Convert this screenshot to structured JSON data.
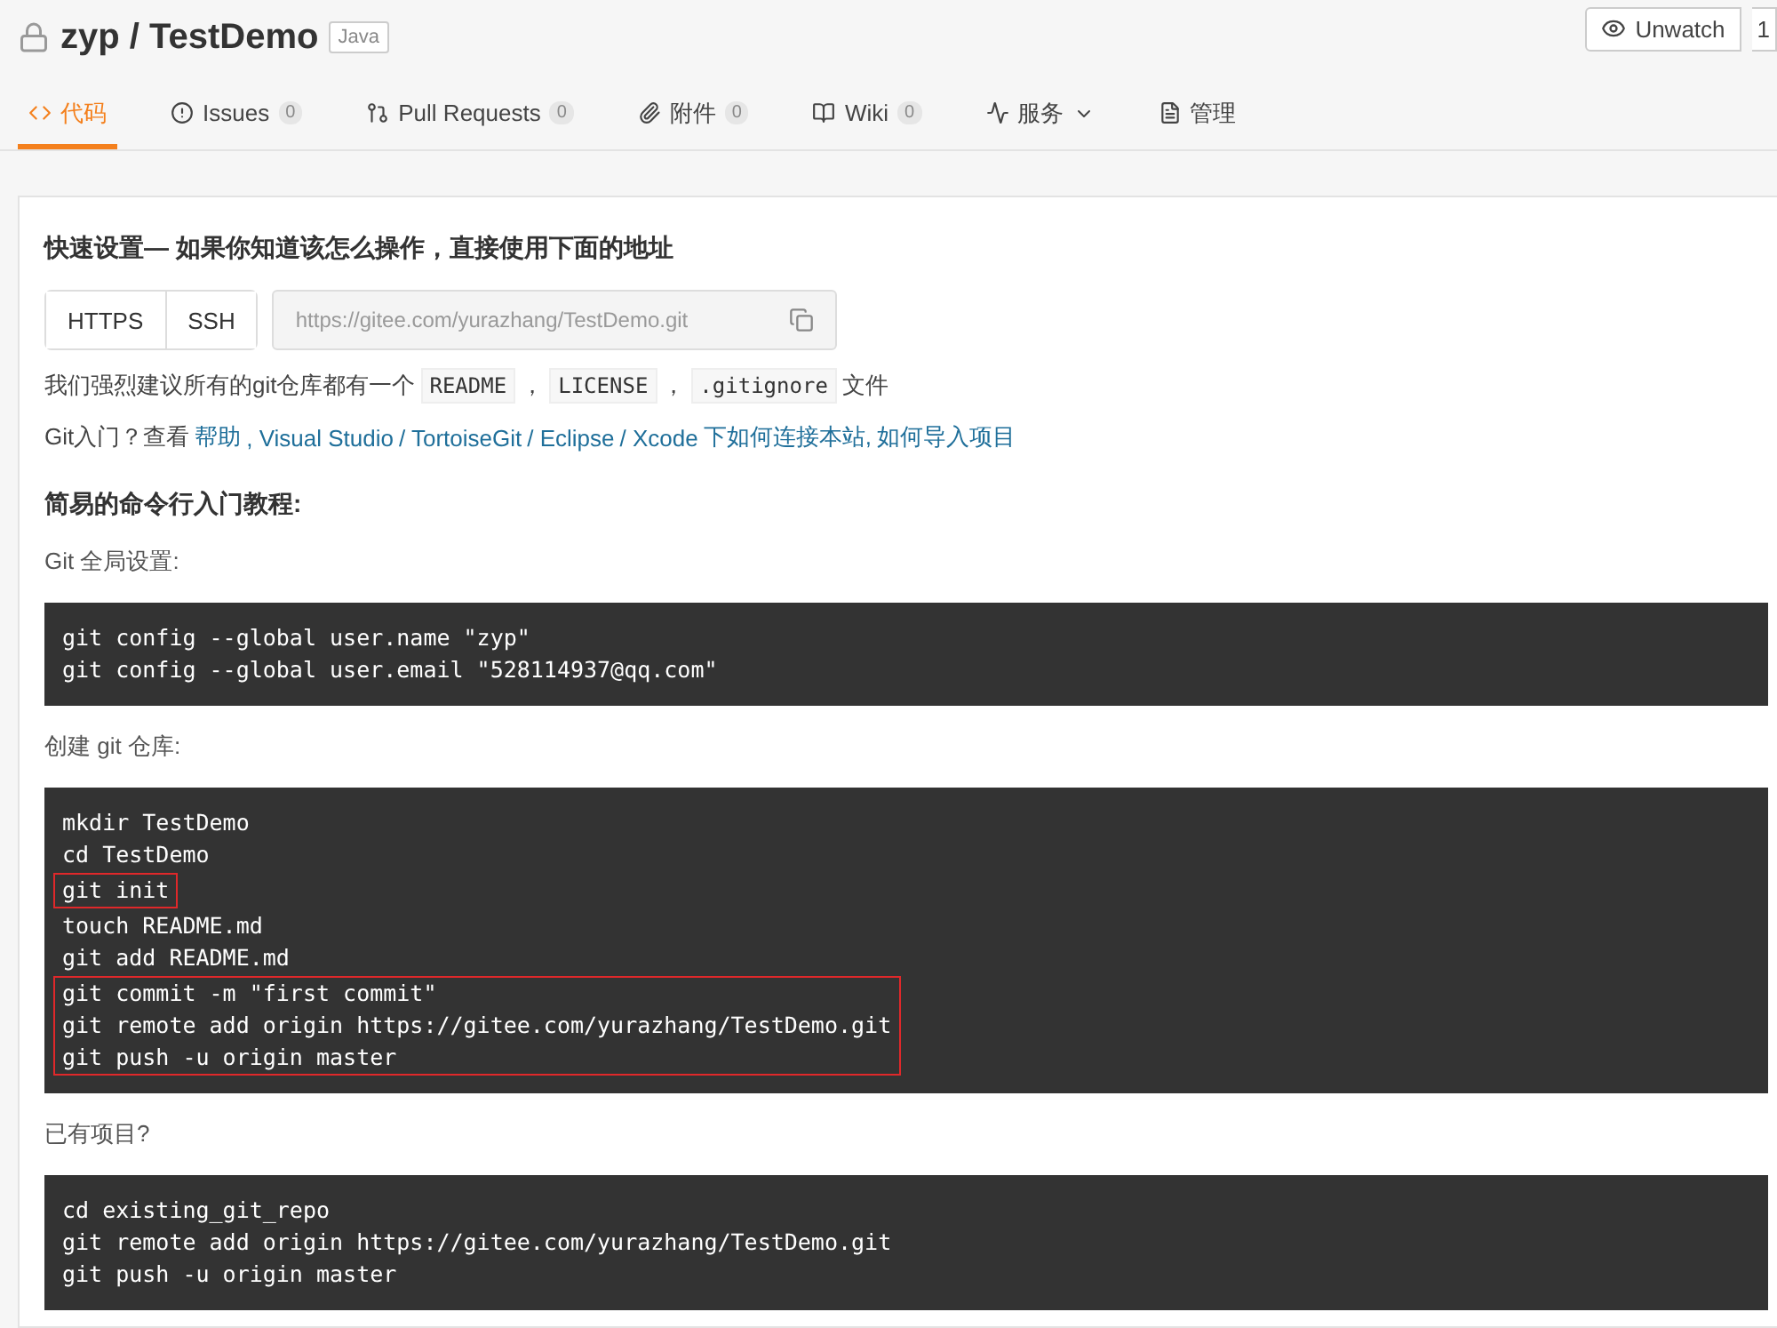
{
  "repo": {
    "owner": "zyp",
    "separator": "/",
    "name": "TestDemo",
    "language": "Java",
    "watch_label": "Unwatch",
    "watch_count": "1"
  },
  "tabs": [
    {
      "label": "代码",
      "selected": true,
      "dropdown": false
    },
    {
      "label": "Issues",
      "count": "0",
      "selected": false,
      "dropdown": false
    },
    {
      "label": "Pull Requests",
      "count": "0",
      "selected": false,
      "dropdown": false
    },
    {
      "label": "附件",
      "count": "0",
      "selected": false,
      "dropdown": false
    },
    {
      "label": "Wiki",
      "count": "0",
      "selected": false,
      "dropdown": false
    },
    {
      "label": "服务",
      "selected": false,
      "dropdown": true
    },
    {
      "label": "管理",
      "selected": false,
      "dropdown": false
    }
  ],
  "quick_setup": {
    "title": "快速设置— 如果你知道该怎么操作，直接使用下面的地址",
    "protocols": [
      {
        "label": "HTTPS",
        "selected": false
      },
      {
        "label": "SSH",
        "selected": false
      }
    ],
    "url": "https://gitee.com/yurazhang/TestDemo.git",
    "recommend": [
      {
        "kind": "text",
        "text": "我们强烈建议所有的git仓库都有一个"
      },
      {
        "kind": "code",
        "text": "README"
      },
      {
        "kind": "text",
        "text": "，"
      },
      {
        "kind": "code",
        "text": "LICENSE"
      },
      {
        "kind": "text",
        "text": "，"
      },
      {
        "kind": "code",
        "text": ".gitignore"
      },
      {
        "kind": "text",
        "text": "文件"
      }
    ],
    "help": [
      {
        "kind": "text",
        "text": "Git入门？查看"
      },
      {
        "kind": "link",
        "text": "帮助"
      },
      {
        "kind": "link",
        "text": ", Visual Studio"
      },
      {
        "kind": "link",
        "text": "/ TortoiseGit"
      },
      {
        "kind": "link",
        "text": "/ Eclipse"
      },
      {
        "kind": "link",
        "text": "/ Xcode"
      },
      {
        "kind": "link",
        "text": "下如何连接本站,"
      },
      {
        "kind": "link",
        "text": "如何导入项目"
      }
    ]
  },
  "tutorial": {
    "title": "简易的命令行入门教程:",
    "sections": [
      {
        "label": "Git 全局设置:",
        "groups": [
          {
            "boxed": false,
            "lines": [
              "git config --global user.name \"zyp\"",
              "git config --global user.email \"528114937@qq.com\""
            ]
          }
        ]
      },
      {
        "label": "创建 git 仓库:",
        "groups": [
          {
            "boxed": false,
            "lines": [
              "mkdir TestDemo",
              "cd TestDemo"
            ]
          },
          {
            "boxed": true,
            "lines": [
              "git init"
            ]
          },
          {
            "boxed": false,
            "lines": [
              "touch README.md",
              "git add README.md"
            ]
          },
          {
            "boxed": true,
            "lines": [
              "git commit -m \"first commit\"",
              "git remote add origin https://gitee.com/yurazhang/TestDemo.git",
              "git push -u origin master"
            ]
          }
        ]
      },
      {
        "label": "已有项目?",
        "groups": [
          {
            "boxed": false,
            "lines": [
              "cd existing_git_repo",
              "git remote add origin https://gitee.com/yurazhang/TestDemo.git",
              "git push -u origin master"
            ]
          }
        ]
      }
    ]
  }
}
